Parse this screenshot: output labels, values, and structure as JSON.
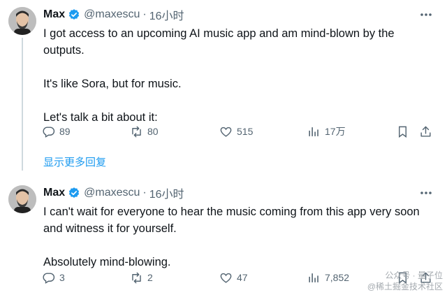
{
  "tweets": [
    {
      "author": "Max",
      "handle": "@maxescu",
      "time": "16小时",
      "paragraphs": [
        "I got access to an upcoming AI music app and am mind-blown by the outputs.",
        "It's like Sora, but for music.",
        "Let's talk a bit about it:"
      ],
      "replies": "89",
      "retweets": "80",
      "likes": "515",
      "views": "17万"
    },
    {
      "author": "Max",
      "handle": "@maxescu",
      "time": "16小时",
      "paragraphs": [
        "I can't wait for everyone to hear the music coming from this app very soon and witness it for yourself.",
        "Absolutely mind-blowing."
      ],
      "replies": "3",
      "retweets": "2",
      "likes": "47",
      "views": "7,852"
    }
  ],
  "show_more_label": "显示更多回复",
  "watermark": {
    "line1": "公众号 · 量子位",
    "line2": "@稀土掘金技术社区"
  },
  "colors": {
    "accent": "#1d9bf0",
    "text": "#0f1419",
    "muted": "#536471",
    "thread_line": "#cfd9de"
  },
  "icons": [
    "reply-icon",
    "retweet-icon",
    "like-icon",
    "views-icon",
    "bookmark-icon",
    "share-icon",
    "more-icon",
    "verified-icon"
  ]
}
